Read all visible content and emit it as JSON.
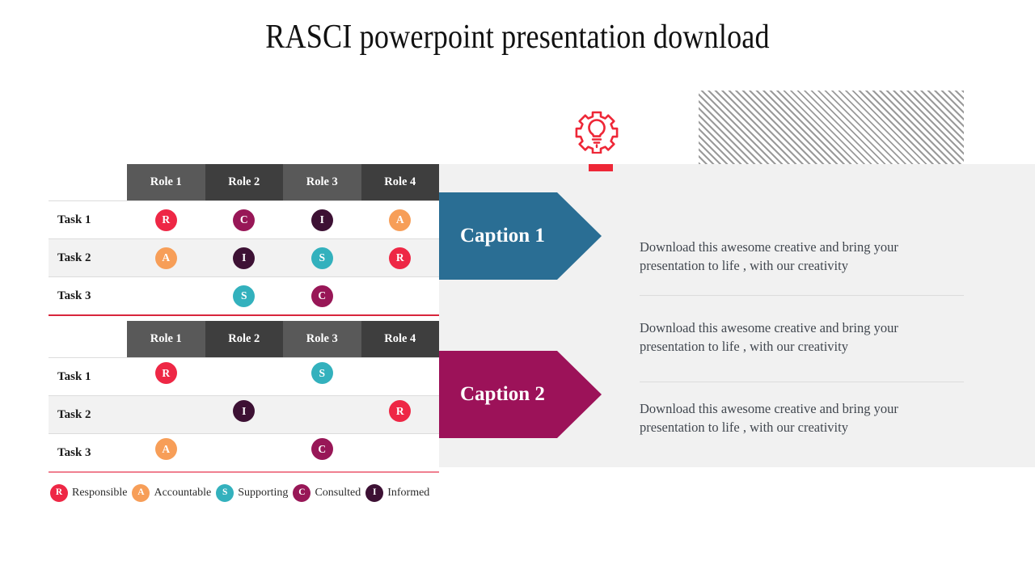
{
  "title": "RASCI powerpoint presentation download",
  "colors": {
    "R": "#ee2745",
    "A": "#f79e58",
    "S": "#33b1bd",
    "C": "#981757",
    "I": "#3d1134",
    "caption1": "#2a6e94",
    "caption2": "#9c1259",
    "header_dark": "#3e3e3e",
    "header_light": "#595959",
    "panel": "#f1f1f1",
    "accent_red": "#ee2737"
  },
  "icons": {
    "gear_bulb": "gear-lightbulb-icon",
    "hatch": "diagonal-hatch-pattern"
  },
  "tables": [
    {
      "id": "table-1",
      "underline_color": "#d8263c",
      "columns": [
        "Role 1",
        "Role 2",
        "Role 3",
        "Role 4"
      ],
      "rows": [
        {
          "task": "Task 1",
          "cells": [
            "R",
            "C",
            "I",
            "A"
          ]
        },
        {
          "task": "Task 2",
          "cells": [
            "A",
            "I",
            "S",
            "R"
          ]
        },
        {
          "task": "Task 3",
          "cells": [
            "",
            "S",
            "C",
            ""
          ]
        }
      ]
    },
    {
      "id": "table-2",
      "underline_color": "#f08090",
      "columns": [
        "Role 1",
        "Role 2",
        "Role 3",
        "Role 4"
      ],
      "rows": [
        {
          "task": "Task 1",
          "cells": [
            "R",
            "",
            "S",
            ""
          ]
        },
        {
          "task": "Task 2",
          "cells": [
            "",
            "I",
            "",
            "R"
          ]
        },
        {
          "task": "Task 3",
          "cells": [
            "A",
            "",
            "C",
            ""
          ]
        }
      ]
    }
  ],
  "captions": [
    {
      "label": "Caption 1",
      "color": "#2a6e94"
    },
    {
      "label": "Caption 2",
      "color": "#9c1259"
    }
  ],
  "paragraphs": [
    "Download this awesome creative and bring your presentation to life , with our creativity",
    "Download this awesome creative and bring your presentation to life , with our creativity",
    "Download this awesome creative and bring your presentation to life , with our creativity"
  ],
  "legend": [
    {
      "key": "R",
      "label": "Responsible",
      "color": "#ee2745"
    },
    {
      "key": "A",
      "label": "Accountable",
      "color": "#f79e58"
    },
    {
      "key": "S",
      "label": "Supporting",
      "color": "#33b1bd"
    },
    {
      "key": "C",
      "label": "Consulted",
      "color": "#981757"
    },
    {
      "key": "I",
      "label": "Informed",
      "color": "#3d1134"
    }
  ]
}
